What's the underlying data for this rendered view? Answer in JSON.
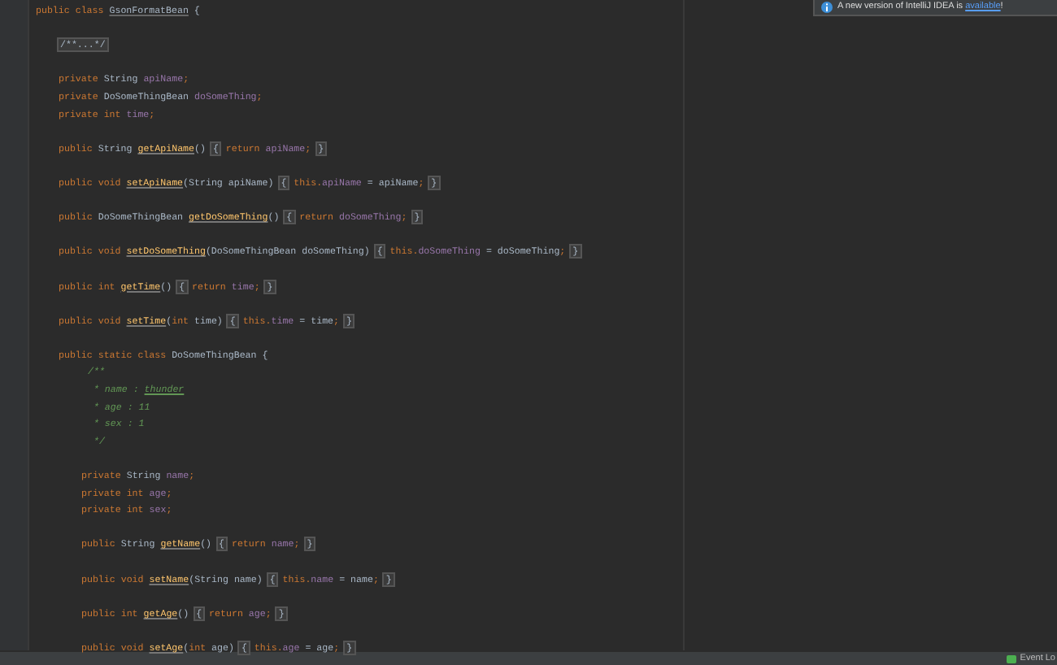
{
  "notification": {
    "text": "A new version of IntelliJ IDEA is ",
    "link": "available",
    "suffix": "!"
  },
  "code": {
    "header": [
      {
        "kind": "kw",
        "text": "public class "
      },
      {
        "kind": "classname",
        "text": "GsonFormatBean"
      },
      {
        "kind": "plain",
        "text": " {"
      }
    ],
    "blocks": [
      [
        [
          {
            "kind": "fold",
            "text": "/**...*/"
          }
        ]
      ],
      [
        [
          {
            "kind": "kw",
            "text": "private "
          },
          {
            "kind": "plain",
            "text": "String "
          },
          {
            "kind": "field",
            "text": "apiName"
          },
          {
            "kind": "kw",
            "text": ";"
          }
        ],
        [
          {
            "kind": "kw",
            "text": "private "
          },
          {
            "kind": "plain",
            "text": "DoSomeThingBean "
          },
          {
            "kind": "field",
            "text": "doSomeThing"
          },
          {
            "kind": "kw",
            "text": ";"
          }
        ],
        [
          {
            "kind": "kw",
            "text": "private int "
          },
          {
            "kind": "field",
            "text": "time"
          },
          {
            "kind": "kw",
            "text": ";"
          }
        ]
      ],
      [
        [
          {
            "kind": "kw",
            "text": "public "
          },
          {
            "kind": "plain",
            "text": "String "
          },
          {
            "kind": "method",
            "text": "getApiName"
          },
          {
            "kind": "plain",
            "text": "() "
          },
          {
            "kind": "fold",
            "text": "{"
          },
          {
            "kind": "kw",
            "text": " return "
          },
          {
            "kind": "field",
            "text": "apiName"
          },
          {
            "kind": "kw",
            "text": "; "
          },
          {
            "kind": "fold",
            "text": "}"
          }
        ]
      ],
      [
        [
          {
            "kind": "kw",
            "text": "public void "
          },
          {
            "kind": "method",
            "text": "setApiName"
          },
          {
            "kind": "plain",
            "text": "(String apiName) "
          },
          {
            "kind": "fold",
            "text": "{"
          },
          {
            "kind": "kw",
            "text": " this."
          },
          {
            "kind": "field",
            "text": "apiName"
          },
          {
            "kind": "plain",
            "text": " = apiName"
          },
          {
            "kind": "kw",
            "text": "; "
          },
          {
            "kind": "fold",
            "text": "}"
          }
        ]
      ],
      [
        [
          {
            "kind": "kw",
            "text": "public "
          },
          {
            "kind": "plain",
            "text": "DoSomeThingBean "
          },
          {
            "kind": "method",
            "text": "getDoSomeThing"
          },
          {
            "kind": "plain",
            "text": "() "
          },
          {
            "kind": "fold",
            "text": "{"
          },
          {
            "kind": "kw",
            "text": " return "
          },
          {
            "kind": "field",
            "text": "doSomeThing"
          },
          {
            "kind": "kw",
            "text": "; "
          },
          {
            "kind": "fold",
            "text": "}"
          }
        ]
      ],
      [
        [
          {
            "kind": "kw",
            "text": "public void "
          },
          {
            "kind": "method",
            "text": "setDoSomeThing"
          },
          {
            "kind": "plain",
            "text": "(DoSomeThingBean doSomeThing) "
          },
          {
            "kind": "fold",
            "text": "{"
          },
          {
            "kind": "kw",
            "text": " this."
          },
          {
            "kind": "field",
            "text": "doSomeThing"
          },
          {
            "kind": "plain",
            "text": " = doSomeThing"
          },
          {
            "kind": "kw",
            "text": "; "
          },
          {
            "kind": "fold",
            "text": "}"
          }
        ]
      ],
      [
        [
          {
            "kind": "kw",
            "text": "public int "
          },
          {
            "kind": "method",
            "text": "getTime"
          },
          {
            "kind": "plain",
            "text": "() "
          },
          {
            "kind": "fold",
            "text": "{"
          },
          {
            "kind": "kw",
            "text": " return "
          },
          {
            "kind": "field",
            "text": "time"
          },
          {
            "kind": "kw",
            "text": "; "
          },
          {
            "kind": "fold",
            "text": "}"
          }
        ]
      ],
      [
        [
          {
            "kind": "kw",
            "text": "public void "
          },
          {
            "kind": "method",
            "text": "setTime"
          },
          {
            "kind": "plain",
            "text": "("
          },
          {
            "kind": "kw",
            "text": "int "
          },
          {
            "kind": "plain",
            "text": "time) "
          },
          {
            "kind": "fold",
            "text": "{"
          },
          {
            "kind": "kw",
            "text": " this."
          },
          {
            "kind": "field",
            "text": "time"
          },
          {
            "kind": "plain",
            "text": " = time"
          },
          {
            "kind": "kw",
            "text": "; "
          },
          {
            "kind": "fold",
            "text": "}"
          }
        ]
      ]
    ],
    "inner_class": {
      "header": [
        {
          "kind": "kw",
          "text": "public static class "
        },
        {
          "kind": "plain",
          "text": "DoSomeThingBean {"
        }
      ],
      "doc": [
        [
          {
            "kind": "comment",
            "text": "/**"
          }
        ],
        [
          {
            "kind": "comment",
            "text": " * name : "
          },
          {
            "kind": "doclink",
            "text": "thunder"
          }
        ],
        [
          {
            "kind": "comment",
            "text": " * age : 11"
          }
        ],
        [
          {
            "kind": "comment",
            "text": " * sex : 1"
          }
        ],
        [
          {
            "kind": "comment",
            "text": " */"
          }
        ]
      ],
      "blocks": [
        [
          [
            {
              "kind": "kw",
              "text": "private "
            },
            {
              "kind": "plain",
              "text": "String "
            },
            {
              "kind": "field",
              "text": "name"
            },
            {
              "kind": "kw",
              "text": ";"
            }
          ],
          [
            {
              "kind": "kw",
              "text": "private int "
            },
            {
              "kind": "field",
              "text": "age"
            },
            {
              "kind": "kw",
              "text": ";"
            }
          ],
          [
            {
              "kind": "kw",
              "text": "private int "
            },
            {
              "kind": "field",
              "text": "sex"
            },
            {
              "kind": "kw",
              "text": ";"
            }
          ]
        ],
        [
          [
            {
              "kind": "kw",
              "text": "public "
            },
            {
              "kind": "plain",
              "text": "String "
            },
            {
              "kind": "method",
              "text": "getName"
            },
            {
              "kind": "plain",
              "text": "() "
            },
            {
              "kind": "fold",
              "text": "{"
            },
            {
              "kind": "kw",
              "text": " return "
            },
            {
              "kind": "field",
              "text": "name"
            },
            {
              "kind": "kw",
              "text": "; "
            },
            {
              "kind": "fold",
              "text": "}"
            }
          ]
        ],
        [
          [
            {
              "kind": "kw",
              "text": "public void "
            },
            {
              "kind": "method",
              "text": "setName"
            },
            {
              "kind": "plain",
              "text": "(String name) "
            },
            {
              "kind": "fold",
              "text": "{"
            },
            {
              "kind": "kw",
              "text": " this."
            },
            {
              "kind": "field",
              "text": "name"
            },
            {
              "kind": "plain",
              "text": " = name"
            },
            {
              "kind": "kw",
              "text": "; "
            },
            {
              "kind": "fold",
              "text": "}"
            }
          ]
        ],
        [
          [
            {
              "kind": "kw",
              "text": "public int "
            },
            {
              "kind": "method",
              "text": "getAge"
            },
            {
              "kind": "plain",
              "text": "() "
            },
            {
              "kind": "fold",
              "text": "{"
            },
            {
              "kind": "kw",
              "text": " return "
            },
            {
              "kind": "field",
              "text": "age"
            },
            {
              "kind": "kw",
              "text": "; "
            },
            {
              "kind": "fold",
              "text": "}"
            }
          ]
        ],
        [
          [
            {
              "kind": "kw",
              "text": "public void "
            },
            {
              "kind": "method",
              "text": "setAge"
            },
            {
              "kind": "plain",
              "text": "("
            },
            {
              "kind": "kw",
              "text": "int "
            },
            {
              "kind": "plain",
              "text": "age) "
            },
            {
              "kind": "fold",
              "text": "{"
            },
            {
              "kind": "kw",
              "text": " this."
            },
            {
              "kind": "field",
              "text": "age"
            },
            {
              "kind": "plain",
              "text": " = age"
            },
            {
              "kind": "kw",
              "text": "; "
            },
            {
              "kind": "fold",
              "text": "}"
            }
          ]
        ]
      ]
    }
  },
  "status_bar": {
    "event_log": "Event Lo"
  }
}
